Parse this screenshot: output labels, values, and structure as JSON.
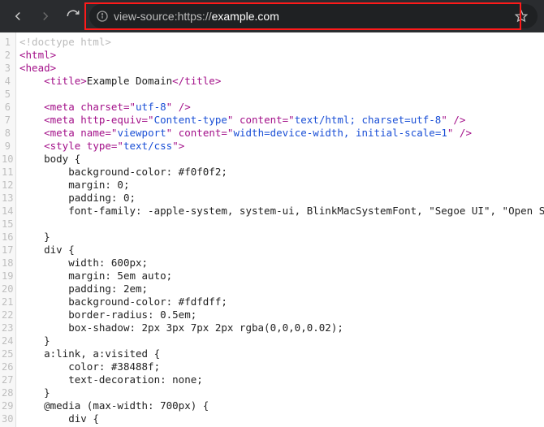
{
  "toolbar": {
    "url_prefix": "view-source:https://",
    "url_host": "example.com",
    "url_suffix": ""
  },
  "lines": [
    {
      "n": 1,
      "ind": 0,
      "segs": [
        {
          "c": "t-doctype",
          "t": "<!doctype html>"
        }
      ]
    },
    {
      "n": 2,
      "ind": 0,
      "segs": [
        {
          "c": "t-tag",
          "t": "<html>"
        }
      ]
    },
    {
      "n": 3,
      "ind": 0,
      "segs": [
        {
          "c": "t-tag",
          "t": "<head>"
        }
      ]
    },
    {
      "n": 4,
      "ind": 1,
      "segs": [
        {
          "c": "t-tag",
          "t": "<title>"
        },
        {
          "c": "t-text",
          "t": "Example Domain"
        },
        {
          "c": "t-tag",
          "t": "</title>"
        }
      ]
    },
    {
      "n": 5,
      "ind": 0,
      "segs": []
    },
    {
      "n": 6,
      "ind": 1,
      "segs": [
        {
          "c": "t-tag",
          "t": "<meta "
        },
        {
          "c": "t-attr",
          "t": "charset"
        },
        {
          "c": "t-tag",
          "t": "=\""
        },
        {
          "c": "t-val",
          "t": "utf-8"
        },
        {
          "c": "t-tag",
          "t": "\" />"
        }
      ]
    },
    {
      "n": 7,
      "ind": 1,
      "segs": [
        {
          "c": "t-tag",
          "t": "<meta "
        },
        {
          "c": "t-attr",
          "t": "http-equiv"
        },
        {
          "c": "t-tag",
          "t": "=\""
        },
        {
          "c": "t-val",
          "t": "Content-type"
        },
        {
          "c": "t-tag",
          "t": "\" "
        },
        {
          "c": "t-attr",
          "t": "content"
        },
        {
          "c": "t-tag",
          "t": "=\""
        },
        {
          "c": "t-val",
          "t": "text/html; charset=utf-8"
        },
        {
          "c": "t-tag",
          "t": "\" />"
        }
      ]
    },
    {
      "n": 8,
      "ind": 1,
      "segs": [
        {
          "c": "t-tag",
          "t": "<meta "
        },
        {
          "c": "t-attr",
          "t": "name"
        },
        {
          "c": "t-tag",
          "t": "=\""
        },
        {
          "c": "t-val",
          "t": "viewport"
        },
        {
          "c": "t-tag",
          "t": "\" "
        },
        {
          "c": "t-attr",
          "t": "content"
        },
        {
          "c": "t-tag",
          "t": "=\""
        },
        {
          "c": "t-val",
          "t": "width=device-width, initial-scale=1"
        },
        {
          "c": "t-tag",
          "t": "\" />"
        }
      ]
    },
    {
      "n": 9,
      "ind": 1,
      "segs": [
        {
          "c": "t-tag",
          "t": "<style "
        },
        {
          "c": "t-attr",
          "t": "type"
        },
        {
          "c": "t-tag",
          "t": "=\""
        },
        {
          "c": "t-val",
          "t": "text/css"
        },
        {
          "c": "t-tag",
          "t": "\">"
        }
      ]
    },
    {
      "n": 10,
      "ind": 1,
      "segs": [
        {
          "c": "t-text",
          "t": "body {"
        }
      ]
    },
    {
      "n": 11,
      "ind": 2,
      "segs": [
        {
          "c": "t-text",
          "t": "background-color: #f0f0f2;"
        }
      ]
    },
    {
      "n": 12,
      "ind": 2,
      "segs": [
        {
          "c": "t-text",
          "t": "margin: 0;"
        }
      ]
    },
    {
      "n": 13,
      "ind": 2,
      "segs": [
        {
          "c": "t-text",
          "t": "padding: 0;"
        }
      ]
    },
    {
      "n": 14,
      "ind": 2,
      "segs": [
        {
          "c": "t-text",
          "t": "font-family: -apple-system, system-ui, BlinkMacSystemFont, \"Segoe UI\", \"Open Sans\""
        }
      ]
    },
    {
      "n": 15,
      "ind": 2,
      "segs": []
    },
    {
      "n": 16,
      "ind": 1,
      "segs": [
        {
          "c": "t-text",
          "t": "}"
        }
      ]
    },
    {
      "n": 17,
      "ind": 1,
      "segs": [
        {
          "c": "t-text",
          "t": "div {"
        }
      ]
    },
    {
      "n": 18,
      "ind": 2,
      "segs": [
        {
          "c": "t-text",
          "t": "width: 600px;"
        }
      ]
    },
    {
      "n": 19,
      "ind": 2,
      "segs": [
        {
          "c": "t-text",
          "t": "margin: 5em auto;"
        }
      ]
    },
    {
      "n": 20,
      "ind": 2,
      "segs": [
        {
          "c": "t-text",
          "t": "padding: 2em;"
        }
      ]
    },
    {
      "n": 21,
      "ind": 2,
      "segs": [
        {
          "c": "t-text",
          "t": "background-color: #fdfdff;"
        }
      ]
    },
    {
      "n": 22,
      "ind": 2,
      "segs": [
        {
          "c": "t-text",
          "t": "border-radius: 0.5em;"
        }
      ]
    },
    {
      "n": 23,
      "ind": 2,
      "segs": [
        {
          "c": "t-text",
          "t": "box-shadow: 2px 3px 7px 2px rgba(0,0,0,0.02);"
        }
      ]
    },
    {
      "n": 24,
      "ind": 1,
      "segs": [
        {
          "c": "t-text",
          "t": "}"
        }
      ]
    },
    {
      "n": 25,
      "ind": 1,
      "segs": [
        {
          "c": "t-text",
          "t": "a:link, a:visited {"
        }
      ]
    },
    {
      "n": 26,
      "ind": 2,
      "segs": [
        {
          "c": "t-text",
          "t": "color: #38488f;"
        }
      ]
    },
    {
      "n": 27,
      "ind": 2,
      "segs": [
        {
          "c": "t-text",
          "t": "text-decoration: none;"
        }
      ]
    },
    {
      "n": 28,
      "ind": 1,
      "segs": [
        {
          "c": "t-text",
          "t": "}"
        }
      ]
    },
    {
      "n": 29,
      "ind": 1,
      "segs": [
        {
          "c": "t-text",
          "t": "@media (max-width: 700px) {"
        }
      ]
    },
    {
      "n": 30,
      "ind": 2,
      "segs": [
        {
          "c": "t-text",
          "t": "div {"
        }
      ]
    }
  ]
}
